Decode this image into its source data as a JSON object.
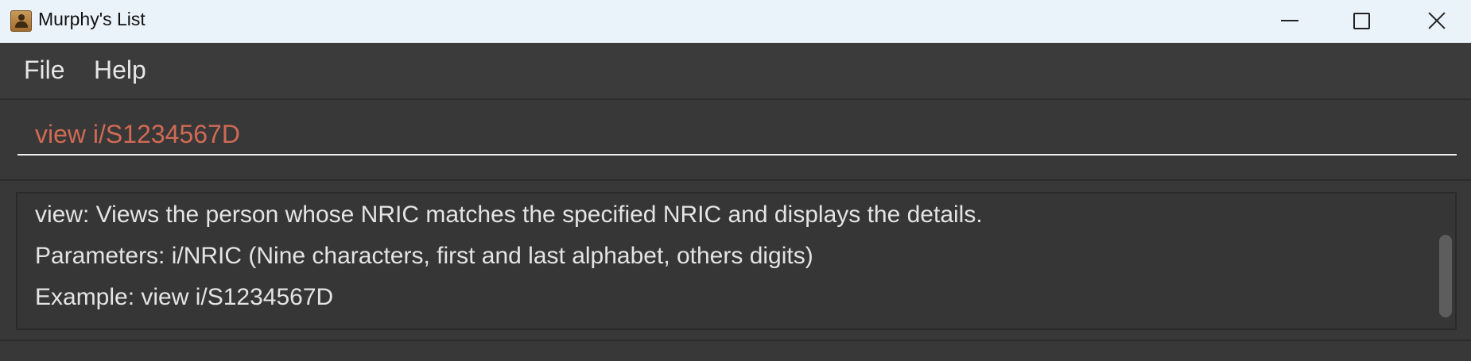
{
  "window": {
    "title": "Murphy's List",
    "icon": "contact-book-icon"
  },
  "menubar": {
    "items": [
      {
        "label": "File"
      },
      {
        "label": "Help"
      }
    ]
  },
  "command_box": {
    "value": "view i/S1234567D",
    "text_color": "#d06a55"
  },
  "result_display": {
    "lines": [
      "view: Views the person whose NRIC matches the specified NRIC and displays the details.",
      "Parameters: i/NRIC (Nine characters, first and last alphabet, others digits)",
      "Example: view i/S1234567D"
    ]
  },
  "colors": {
    "background": "#383838",
    "titlebar": "#eaf3fa",
    "text": "#e4e4e4"
  }
}
